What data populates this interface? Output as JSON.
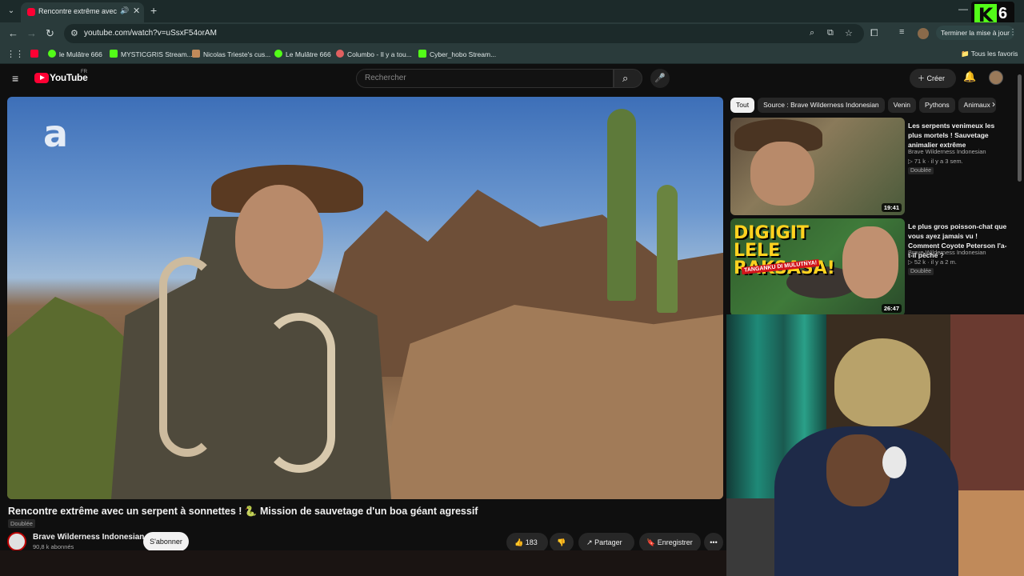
{
  "browser": {
    "tab": {
      "title": "Rencontre extrême avec un serpent à sonnettes !",
      "audio_icon": "speaker-icon",
      "close_glyph": "✕"
    },
    "tab_list_glyph": "⌄",
    "new_tab_glyph": "+",
    "minimize_glyph": "—",
    "url": "youtube.com/watch?v=uSsxF54orAM",
    "update_button": "Terminer la mise à jour",
    "bookmarks": [
      {
        "label": "le Mulâtre 666",
        "color": "#53fc18"
      },
      {
        "label": "MYSTICGRIS Stream...",
        "color": "#53fc18"
      },
      {
        "label": "Nicolas Trieste's cus...",
        "color": "#c08a5a"
      },
      {
        "label": "Le Mulâtre 666",
        "color": "#53fc18"
      },
      {
        "label": "Columbo - Il y a tou...",
        "color": "#e06060"
      },
      {
        "label": "Cyber_hobo Stream...",
        "color": "#53fc18"
      }
    ],
    "all_favorites": "Tous les favoris"
  },
  "overlay_badge": {
    "letter": "K",
    "number": "6"
  },
  "youtube": {
    "logo": "YouTube",
    "region": "FR",
    "search_placeholder": "Rechercher",
    "create_label": "Créer",
    "video": {
      "channel_watermark": "a",
      "title": "Rencontre extrême avec un serpent à sonnettes ! 🐍 Mission de sauvetage d'un boa géant agressif",
      "dubbed": "Doublée",
      "channel": "Brave Wilderness Indonesian",
      "subscribers": "90,8 k abonnés",
      "subscribe": "S'abonner",
      "likes": "183",
      "share": "Partager",
      "save": "Enregistrer"
    },
    "chips": [
      "Tout",
      "Source : Brave Wilderness Indonesian",
      "Venin",
      "Pythons",
      "Animaux"
    ],
    "recommendations": [
      {
        "title": "Les serpents venimeux les plus mortels ! Sauvetage animalier extrême",
        "channel": "Brave Wilderness Indonesian",
        "meta": "71 k · il y a 3 sem.",
        "badge": "Doublée",
        "duration": "19:41"
      },
      {
        "title": "Le plus gros poisson-chat que vous ayez jamais vu ! Comment Coyote Peterson l'a-t-il pêché ?",
        "channel": "Brave Wilderness Indonesian",
        "meta": "52 k · il y a 2 m.",
        "badge": "Doublée",
        "duration": "26:47",
        "thumb_text": "DIGIGIT LELE RAKSASA!",
        "thumb_subtext": "TANGANKU DI MULUTNYA!"
      }
    ]
  },
  "icons": {
    "back": "←",
    "forward": "→",
    "reload": "↻",
    "search": "⌕",
    "star": "☆",
    "menu": "≡",
    "bell": "🔔",
    "mic": "🎤",
    "like": "👍",
    "dislike": "👎",
    "share": "↗",
    "save": "🔖",
    "more": "•••",
    "next": "›",
    "apps": "⋮⋮",
    "kebab": "⋮"
  }
}
